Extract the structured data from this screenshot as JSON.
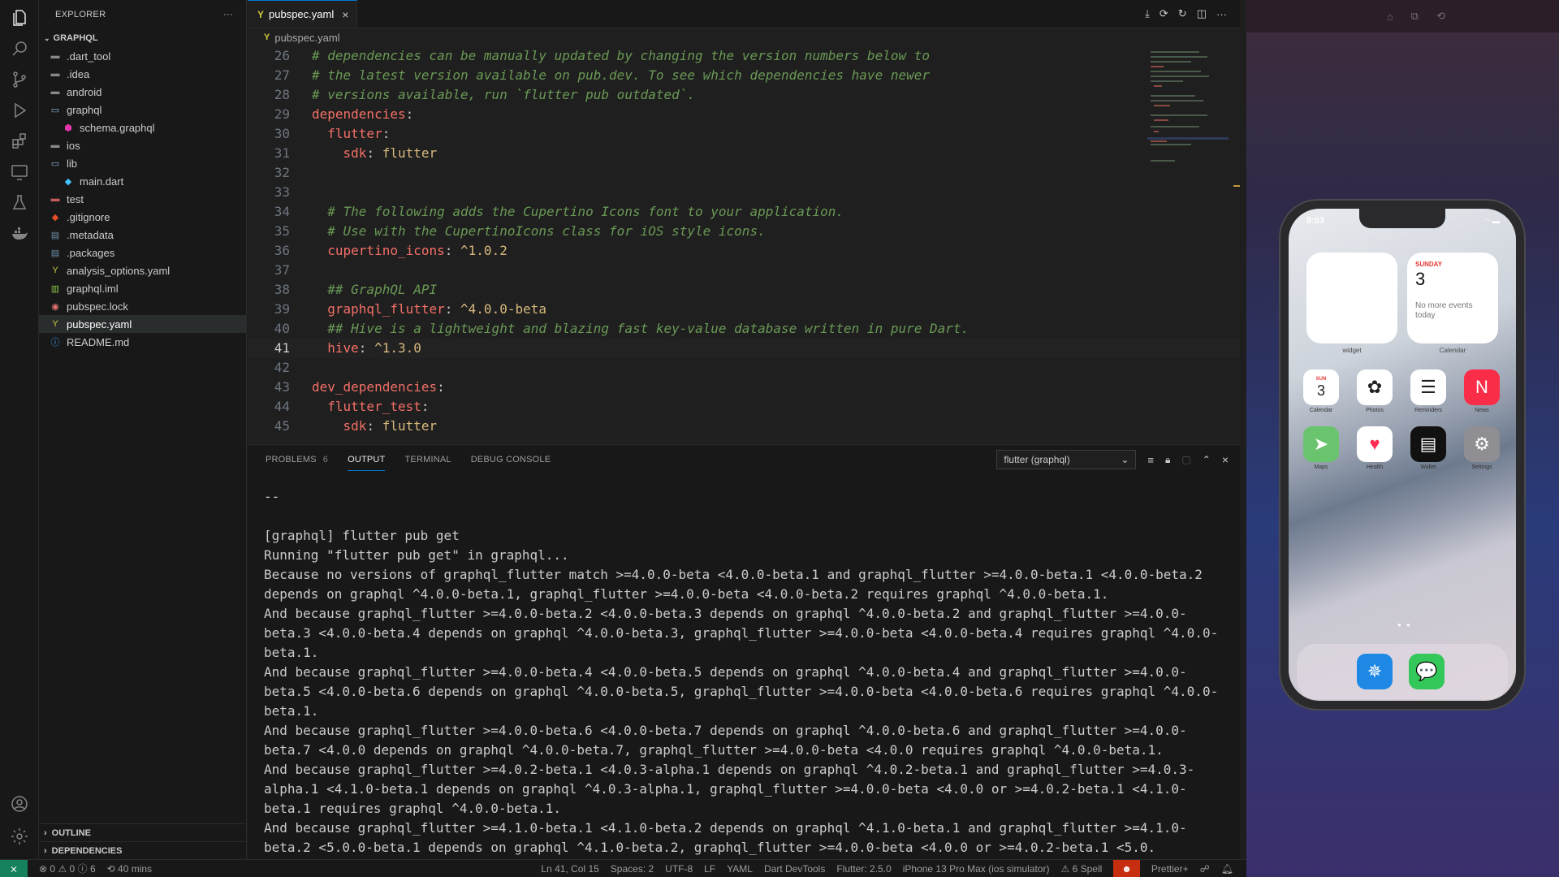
{
  "explorer": {
    "title": "EXPLORER",
    "more": "···",
    "root": "GRAPHQL",
    "items": [
      {
        "label": ".dart_tool",
        "type": "folder"
      },
      {
        "label": ".idea",
        "type": "folder"
      },
      {
        "label": "android",
        "type": "folder"
      },
      {
        "label": "graphql",
        "type": "folder-open"
      },
      {
        "label": "schema.graphql",
        "type": "graphql"
      },
      {
        "label": "ios",
        "type": "folder"
      },
      {
        "label": "lib",
        "type": "folder-open"
      },
      {
        "label": "main.dart",
        "type": "dart"
      },
      {
        "label": "test",
        "type": "folder-test"
      },
      {
        "label": ".gitignore",
        "type": "git"
      },
      {
        "label": ".metadata",
        "type": "file"
      },
      {
        "label": ".packages",
        "type": "file"
      },
      {
        "label": "analysis_options.yaml",
        "type": "yaml"
      },
      {
        "label": "graphql.iml",
        "type": "iml"
      },
      {
        "label": "pubspec.lock",
        "type": "lock"
      },
      {
        "label": "pubspec.yaml",
        "type": "yaml"
      },
      {
        "label": "README.md",
        "type": "info"
      }
    ],
    "outline": "OUTLINE",
    "dependencies": "DEPENDENCIES"
  },
  "editor": {
    "tab_label": "pubspec.yaml",
    "breadcrumb": "pubspec.yaml",
    "lines": [
      {
        "n": "26",
        "comment": "# dependencies can be manually updated by changing the version numbers below to"
      },
      {
        "n": "27",
        "comment": "# the latest version available on pub.dev. To see which dependencies have newer"
      },
      {
        "n": "28",
        "comment": "# versions available, run `flutter pub outdated`."
      },
      {
        "n": "29",
        "key": "dependencies",
        "indent": ""
      },
      {
        "n": "30",
        "key": "flutter",
        "indent": "  "
      },
      {
        "n": "31",
        "key": "sdk",
        "value": "flutter",
        "indent": "    "
      },
      {
        "n": "32"
      },
      {
        "n": "33"
      },
      {
        "n": "34",
        "comment": "  # The following adds the Cupertino Icons font to your application."
      },
      {
        "n": "35",
        "comment": "  # Use with the CupertinoIcons class for iOS style icons."
      },
      {
        "n": "36",
        "key": "cupertino_icons",
        "value": "^1.0.2",
        "indent": "  "
      },
      {
        "n": "37"
      },
      {
        "n": "38",
        "comment": "  ## GraphQL API"
      },
      {
        "n": "39",
        "key": "graphql_flutter",
        "value": "^4.0.0-beta",
        "indent": "  "
      },
      {
        "n": "40",
        "comment": "  ## Hive is a lightweight and blazing fast key-value database written in pure Dart."
      },
      {
        "n": "41",
        "key": "hive",
        "value": "^1.3.0",
        "indent": "  ",
        "current": true
      },
      {
        "n": "42"
      },
      {
        "n": "43",
        "key": "dev_dependencies",
        "indent": ""
      },
      {
        "n": "44",
        "key": "flutter_test",
        "indent": "  "
      },
      {
        "n": "45",
        "key": "sdk",
        "value": "flutter",
        "indent": "    "
      }
    ]
  },
  "panel": {
    "tabs": [
      {
        "label": "PROBLEMS",
        "count": "6"
      },
      {
        "label": "OUTPUT",
        "active": true
      },
      {
        "label": "TERMINAL"
      },
      {
        "label": "DEBUG CONSOLE"
      }
    ],
    "channel": "flutter (graphql)",
    "output": "--\n\n[graphql] flutter pub get\nRunning \"flutter pub get\" in graphql...\nBecause no versions of graphql_flutter match >=4.0.0-beta <4.0.0-beta.1 and graphql_flutter >=4.0.0-beta.1 <4.0.0-beta.2 depends on graphql ^4.0.0-beta.1, graphql_flutter >=4.0.0-beta <4.0.0-beta.2 requires graphql ^4.0.0-beta.1.\nAnd because graphql_flutter >=4.0.0-beta.2 <4.0.0-beta.3 depends on graphql ^4.0.0-beta.2 and graphql_flutter >=4.0.0-beta.3 <4.0.0-beta.4 depends on graphql ^4.0.0-beta.3, graphql_flutter >=4.0.0-beta <4.0.0-beta.4 requires graphql ^4.0.0-beta.1.\nAnd because graphql_flutter >=4.0.0-beta.4 <4.0.0-beta.5 depends on graphql ^4.0.0-beta.4 and graphql_flutter >=4.0.0-beta.5 <4.0.0-beta.6 depends on graphql ^4.0.0-beta.5, graphql_flutter >=4.0.0-beta <4.0.0-beta.6 requires graphql ^4.0.0-beta.1.\nAnd because graphql_flutter >=4.0.0-beta.6 <4.0.0-beta.7 depends on graphql ^4.0.0-beta.6 and graphql_flutter >=4.0.0-beta.7 <4.0.0 depends on graphql ^4.0.0-beta.7, graphql_flutter >=4.0.0-beta <4.0.0 requires graphql ^4.0.0-beta.1.\nAnd because graphql_flutter >=4.0.2-beta.1 <4.0.3-alpha.1 depends on graphql ^4.0.2-beta.1 and graphql_flutter >=4.0.3-alpha.1 <4.1.0-beta.1 depends on graphql ^4.0.3-alpha.1, graphql_flutter >=4.0.0-beta <4.0.0 or >=4.0.2-beta.1 <4.1.0-beta.1 requires graphql ^4.0.0-beta.1.\nAnd because graphql_flutter >=4.1.0-beta.1 <4.1.0-beta.2 depends on graphql ^4.1.0-beta.1 and graphql_flutter >=4.1.0-beta.2 <5.0.0-beta.1 depends on graphql ^4.1.0-beta.2, graphql_flutter >=4.0.0-beta <4.0.0 or >=4.0.2-beta.1 <5.0."
  },
  "status": {
    "remote": "⨯",
    "errors": "0",
    "warnings": "0",
    "infos": "6",
    "time": "40 mins",
    "position": "Ln 41, Col 15",
    "spaces": "Spaces: 2",
    "encoding": "UTF-8",
    "eol": "LF",
    "language": "YAML",
    "devtools": "Dart DevTools",
    "flutter": "Flutter: 2.5.0",
    "device": "iPhone 13 Pro Max (ios simulator)",
    "spell": "6 Spell",
    "prettier": "Prettier+"
  },
  "phone": {
    "time": "9:03",
    "widget_label": "widget",
    "calendar_widget": {
      "day": "SUNDAY",
      "date": "3",
      "note": "No more events today",
      "label": "Calendar"
    },
    "apps": [
      {
        "label": "Calendar",
        "icon": "calendar-icon",
        "glyph_top": "SUN",
        "glyph": "3",
        "color": "#ffffff"
      },
      {
        "label": "Photos",
        "icon": "photos-icon",
        "glyph": "✿",
        "color": "#ffffff"
      },
      {
        "label": "Reminders",
        "icon": "reminders-icon",
        "glyph": "☰",
        "color": "#ffffff"
      },
      {
        "label": "News",
        "icon": "news-icon",
        "glyph": "N",
        "color": "#fa2d48"
      },
      {
        "label": "Maps",
        "icon": "maps-icon",
        "glyph": "➤",
        "color": "#6ac46e"
      },
      {
        "label": "Health",
        "icon": "health-icon",
        "glyph": "♥",
        "color": "#ffffff"
      },
      {
        "label": "Wallet",
        "icon": "wallet-icon",
        "glyph": "▤",
        "color": "#111111"
      },
      {
        "label": "Settings",
        "icon": "settings-icon",
        "glyph": "⚙",
        "color": "#8e8e93"
      }
    ],
    "dock": [
      {
        "icon": "safari-icon",
        "glyph": "✵",
        "color": "#1e88e5"
      },
      {
        "icon": "messages-icon",
        "glyph": "💬",
        "color": "#34c759"
      }
    ]
  }
}
